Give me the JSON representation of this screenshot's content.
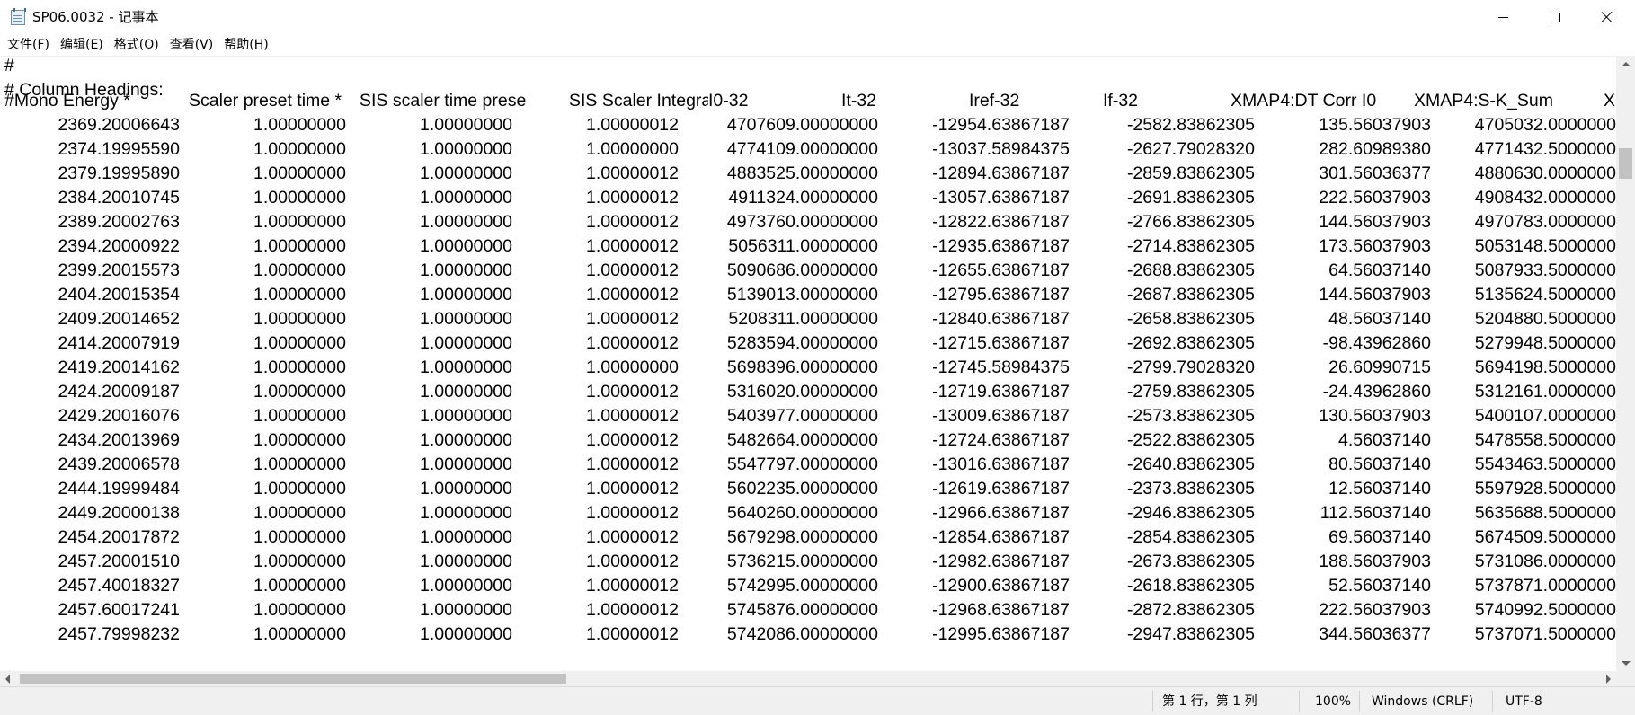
{
  "window": {
    "title": "SP06.0032 - 记事本",
    "icon": "notepad-icon",
    "controls": {
      "minimize": "minimize-icon",
      "maximize": "maximize-icon",
      "close": "close-icon"
    }
  },
  "menu": [
    "文件(F)",
    "编辑(E)",
    "格式(O)",
    "查看(V)",
    "帮助(H)"
  ],
  "editor": {
    "comment_lines": [
      "#",
      "# Column Headings:"
    ],
    "headers": [
      "#Mono Energy *",
      "Scaler preset time *",
      "SIS scaler time prese",
      "SIS Scaler Integratio",
      "I0-32",
      "It-32",
      "Iref-32",
      "If-32",
      "XMAP4:DT Corr I0",
      "XMAP4:S-K_Sum",
      "X"
    ],
    "rows": [
      [
        "2369.20006643",
        "1.00000000",
        "1.00000000",
        "1.00000012",
        "4707609.00000000",
        "-12954.63867187",
        "-2582.83862305",
        "135.56037903",
        "4705032.0000000"
      ],
      [
        "2374.19995590",
        "1.00000000",
        "1.00000000",
        "1.00000000",
        "4774109.00000000",
        "-13037.58984375",
        "-2627.79028320",
        "282.60989380",
        "4771432.5000000"
      ],
      [
        "2379.19995890",
        "1.00000000",
        "1.00000000",
        "1.00000012",
        "4883525.00000000",
        "-12894.63867187",
        "-2859.83862305",
        "301.56036377",
        "4880630.0000000"
      ],
      [
        "2384.20010745",
        "1.00000000",
        "1.00000000",
        "1.00000012",
        "4911324.00000000",
        "-13057.63867187",
        "-2691.83862305",
        "222.56037903",
        "4908432.0000000"
      ],
      [
        "2389.20002763",
        "1.00000000",
        "1.00000000",
        "1.00000012",
        "4973760.00000000",
        "-12822.63867187",
        "-2766.83862305",
        "144.56037903",
        "4970783.0000000"
      ],
      [
        "2394.20000922",
        "1.00000000",
        "1.00000000",
        "1.00000012",
        "5056311.00000000",
        "-12935.63867187",
        "-2714.83862305",
        "173.56037903",
        "5053148.5000000"
      ],
      [
        "2399.20015573",
        "1.00000000",
        "1.00000000",
        "1.00000012",
        "5090686.00000000",
        "-12655.63867187",
        "-2688.83862305",
        "64.56037140",
        "5087933.5000000"
      ],
      [
        "2404.20015354",
        "1.00000000",
        "1.00000000",
        "1.00000012",
        "5139013.00000000",
        "-12795.63867187",
        "-2687.83862305",
        "144.56037903",
        "5135624.5000000"
      ],
      [
        "2409.20014652",
        "1.00000000",
        "1.00000000",
        "1.00000012",
        "5208311.00000000",
        "-12840.63867187",
        "-2658.83862305",
        "48.56037140",
        "5204880.5000000"
      ],
      [
        "2414.20007919",
        "1.00000000",
        "1.00000000",
        "1.00000012",
        "5283594.00000000",
        "-12715.63867187",
        "-2692.83862305",
        "-98.43962860",
        "5279948.5000000"
      ],
      [
        "2419.20014162",
        "1.00000000",
        "1.00000000",
        "1.00000000",
        "5698396.00000000",
        "-12745.58984375",
        "-2799.79028320",
        "26.60990715",
        "5694198.5000000"
      ],
      [
        "2424.20009187",
        "1.00000000",
        "1.00000000",
        "1.00000012",
        "5316020.00000000",
        "-12719.63867187",
        "-2759.83862305",
        "-24.43962860",
        "5312161.0000000"
      ],
      [
        "2429.20016076",
        "1.00000000",
        "1.00000000",
        "1.00000012",
        "5403977.00000000",
        "-13009.63867187",
        "-2573.83862305",
        "130.56037903",
        "5400107.0000000"
      ],
      [
        "2434.20013969",
        "1.00000000",
        "1.00000000",
        "1.00000012",
        "5482664.00000000",
        "-12724.63867187",
        "-2522.83862305",
        "4.56037140",
        "5478558.5000000"
      ],
      [
        "2439.20006578",
        "1.00000000",
        "1.00000000",
        "1.00000012",
        "5547797.00000000",
        "-13016.63867187",
        "-2640.83862305",
        "80.56037140",
        "5543463.5000000"
      ],
      [
        "2444.19999484",
        "1.00000000",
        "1.00000000",
        "1.00000012",
        "5602235.00000000",
        "-12619.63867187",
        "-2373.83862305",
        "12.56037140",
        "5597928.5000000"
      ],
      [
        "2449.20000138",
        "1.00000000",
        "1.00000000",
        "1.00000012",
        "5640260.00000000",
        "-12966.63867187",
        "-2946.83862305",
        "112.56037140",
        "5635688.5000000"
      ],
      [
        "2454.20017872",
        "1.00000000",
        "1.00000000",
        "1.00000012",
        "5679298.00000000",
        "-12854.63867187",
        "-2854.83862305",
        "69.56037140",
        "5674509.5000000"
      ],
      [
        "2457.20001510",
        "1.00000000",
        "1.00000000",
        "1.00000012",
        "5736215.00000000",
        "-12982.63867187",
        "-2673.83862305",
        "188.56037903",
        "5731086.0000000"
      ],
      [
        "2457.40018327",
        "1.00000000",
        "1.00000000",
        "1.00000012",
        "5742995.00000000",
        "-12900.63867187",
        "-2618.83862305",
        "52.56037140",
        "5737871.0000000"
      ],
      [
        "2457.60017241",
        "1.00000000",
        "1.00000000",
        "1.00000012",
        "5745876.00000000",
        "-12968.63867187",
        "-2872.83862305",
        "222.56037903",
        "5740992.5000000"
      ],
      [
        "2457.79998232",
        "1.00000000",
        "1.00000000",
        "1.00000012",
        "5742086.00000000",
        "-12995.63867187",
        "-2947.83862305",
        "344.56036377",
        "5737071.5000000"
      ]
    ]
  },
  "statusbar": {
    "position": "第 1 行，第 1 列",
    "zoom": "100%",
    "line_ending": "Windows (CRLF)",
    "encoding": "UTF-8"
  },
  "colors": {
    "chrome_bg": "#f0f0f0",
    "scroll_thumb": "#c2c2c2",
    "text": "#000000"
  }
}
